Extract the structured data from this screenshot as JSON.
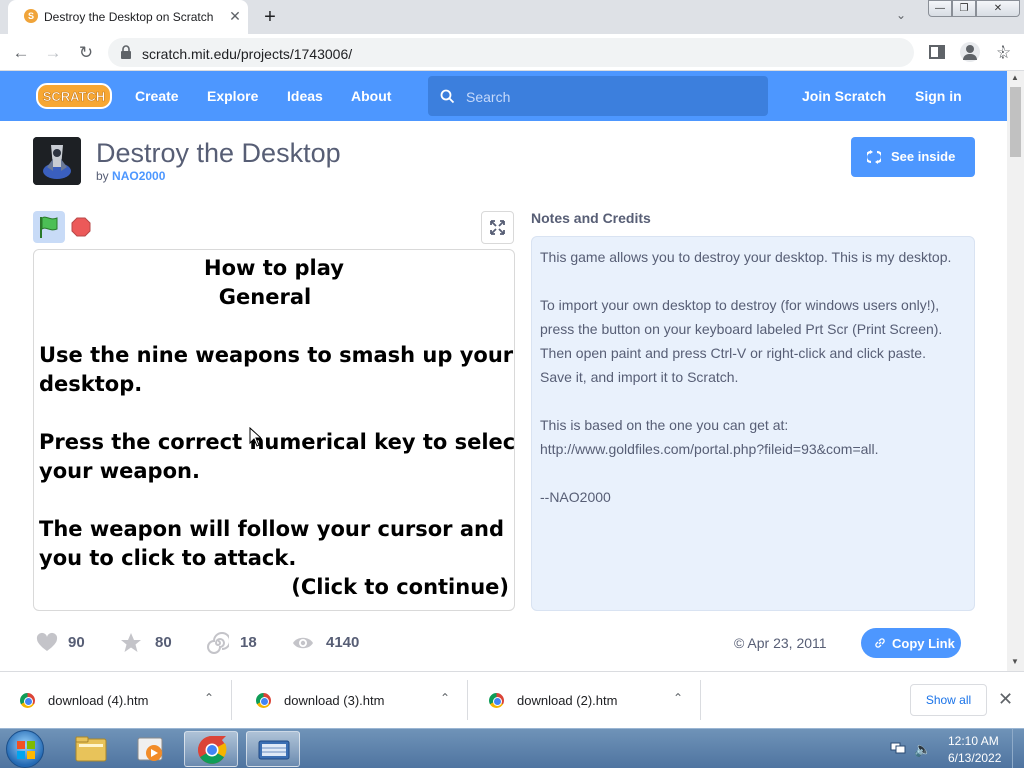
{
  "browser": {
    "tab_title": "Destroy the Desktop on Scratch",
    "tab_close": "✕",
    "new_tab": "+",
    "url": "scratch.mit.edu/projects/1743006/",
    "window_min": "—",
    "window_max": "❐",
    "window_close": "✕"
  },
  "nav": {
    "logo": "SCRATCH",
    "links": [
      "Create",
      "Explore",
      "Ideas",
      "About"
    ],
    "search_placeholder": "Search",
    "join": "Join Scratch",
    "sign_in": "Sign in"
  },
  "project": {
    "title": "Destroy the Desktop",
    "by_label": "by",
    "author": "NAO2000",
    "see_inside": "See inside"
  },
  "stage": {
    "lines": [
      "How to play",
      "General",
      "Use the nine weapons to smash up your",
      "desktop.",
      "Press the correct numerical key to select",
      "your weapon.",
      "The weapon will follow your cursor and",
      "you to click to attack.",
      "(Click to continue)"
    ]
  },
  "notes": {
    "heading": "Notes and Credits",
    "paragraphs": [
      "This game allows you to destroy your desktop. This is my desktop.",
      "To import your own desktop to destroy (for windows users only!), press the button on your keyboard labeled Prt Scr (Print Screen). Then open paint and press Ctrl-V or right-click and click paste. Save it, and import it to Scratch.",
      "This is based on the one you can get at: http://www.goldfiles.com/portal.php?fileid=93&com=all.",
      "--NAO2000"
    ]
  },
  "stats": {
    "loves": "90",
    "favorites": "80",
    "remixes": "18",
    "views": "4140",
    "shared_date": "© Apr 23, 2011",
    "copy_link": "Copy Link"
  },
  "downloads": {
    "items": [
      "download (4).htm",
      "download (3).htm",
      "download (2).htm"
    ],
    "show_all": "Show all",
    "close": "✕"
  },
  "taskbar": {
    "time": "12:10 AM",
    "date": "6/13/2022"
  },
  "colors": {
    "scratch_blue": "#4d97ff",
    "notes_bg": "#e9f1fc",
    "text": "#575e75"
  }
}
